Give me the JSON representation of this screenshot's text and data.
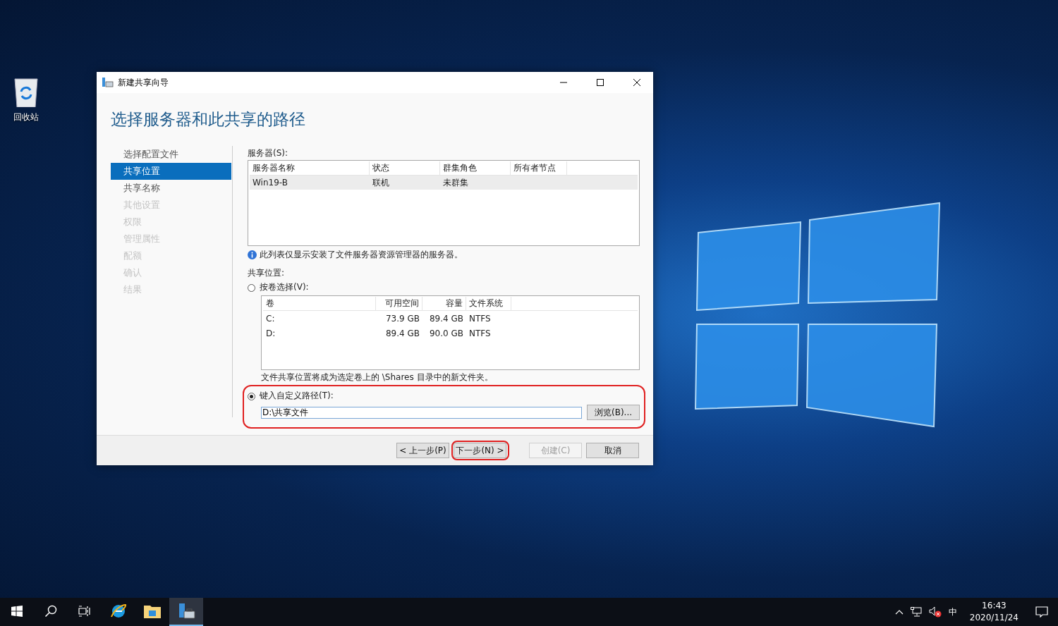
{
  "desktop_icons": [
    {
      "label": "回收站"
    }
  ],
  "window": {
    "title": "新建共享向导",
    "heading": "选择服务器和此共享的路径",
    "nav": [
      {
        "label": "选择配置文件",
        "selected": false,
        "disabled": false
      },
      {
        "label": "共享位置",
        "selected": true,
        "disabled": false
      },
      {
        "label": "共享名称",
        "selected": false,
        "disabled": false
      },
      {
        "label": "其他设置",
        "selected": false,
        "disabled": true
      },
      {
        "label": "权限",
        "selected": false,
        "disabled": true
      },
      {
        "label": "管理属性",
        "selected": false,
        "disabled": true
      },
      {
        "label": "配额",
        "selected": false,
        "disabled": true
      },
      {
        "label": "确认",
        "selected": false,
        "disabled": true
      },
      {
        "label": "结果",
        "selected": false,
        "disabled": true
      }
    ],
    "servers": {
      "label": "服务器(S):",
      "columns": [
        "服务器名称",
        "状态",
        "群集角色",
        "所有者节点"
      ],
      "rows": [
        {
          "cells": [
            "Win19-B",
            "联机",
            "未群集",
            ""
          ],
          "selected": true
        }
      ]
    },
    "info_note": "此列表仅显示安装了文件服务器资源管理器的服务器。",
    "share_location_label": "共享位置:",
    "volume_option": {
      "label": "按卷选择(V):",
      "selected": false
    },
    "volumes": {
      "columns": [
        "卷",
        "可用空间",
        "容量",
        "文件系统"
      ],
      "rows": [
        {
          "cells": [
            "C:",
            "73.9 GB",
            "89.4 GB",
            "NTFS"
          ],
          "selected": false
        },
        {
          "cells": [
            "D:",
            "89.4 GB",
            "90.0 GB",
            "NTFS"
          ],
          "selected": false
        }
      ]
    },
    "volume_note": "文件共享位置将成为选定卷上的 \\Shares 目录中的新文件夹。",
    "custom_option": {
      "label": "键入自定义路径(T):",
      "selected": true,
      "highlighted": true
    },
    "path_field": {
      "value": "D:\\共享文件"
    },
    "browse_button": "浏览(B)...",
    "buttons": [
      {
        "label": "< 上一步(P)",
        "disabled": false,
        "highlighted": false
      },
      {
        "label": "下一步(N) >",
        "disabled": false,
        "highlighted": true
      },
      {
        "label": "创建(C)",
        "disabled": true,
        "highlighted": false
      },
      {
        "label": "取消",
        "disabled": false,
        "highlighted": false
      }
    ]
  },
  "taskbar": {
    "items": [
      {
        "kind": "start",
        "selected": false
      },
      {
        "kind": "search",
        "selected": false
      },
      {
        "kind": "taskview",
        "selected": false
      },
      {
        "kind": "ie",
        "selected": false
      },
      {
        "kind": "explorer",
        "selected": false
      },
      {
        "kind": "servermanager",
        "selected": true
      }
    ],
    "ime": "中",
    "time": "16:43",
    "date": "2020/11/24"
  }
}
